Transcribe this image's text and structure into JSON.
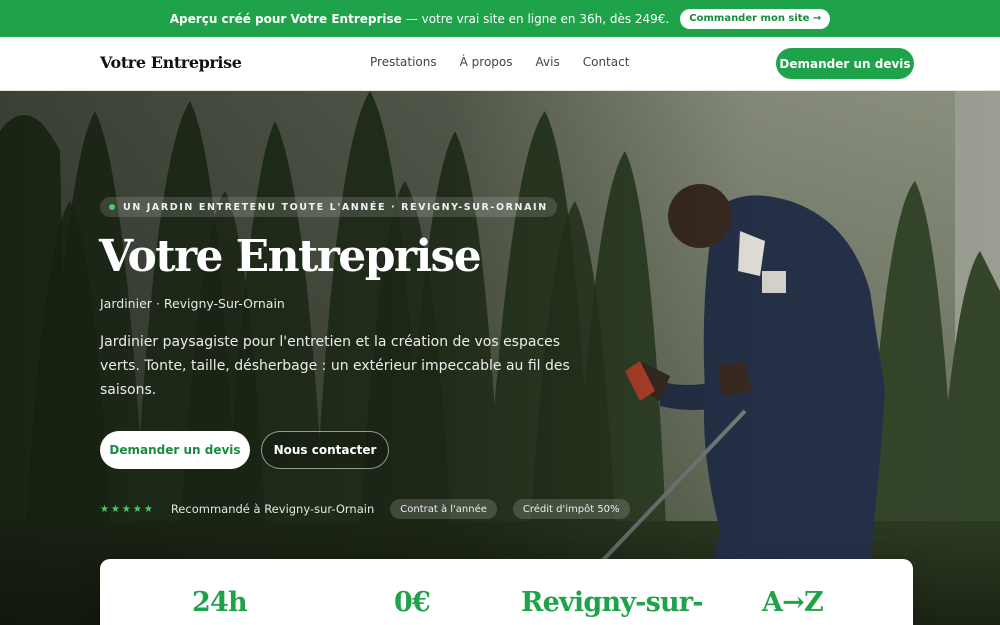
{
  "promo": {
    "bold": "Aperçu créé pour Votre Entreprise",
    "text": "— votre vrai site en ligne en 36h, dès 249€.",
    "button": "Commander mon site →"
  },
  "header": {
    "logo": "Votre Entreprise",
    "nav": [
      "Prestations",
      "À propos",
      "Avis",
      "Contact"
    ],
    "cta": "Demander un devis"
  },
  "hero": {
    "kicker": "UN JARDIN ENTRETENU TOUTE L'ANNÉE · REVIGNY-SUR-ORNAIN",
    "title": "Votre Entreprise",
    "subtitle": "Jardinier · Revigny-Sur-Ornain",
    "lead": "Jardinier paysagiste pour l'entretien et la création de vos espaces verts. Tonte, taille, désherbage : un extérieur impeccable au fil des saisons.",
    "primary_button": "Demander un devis",
    "secondary_button": "Nous contacter",
    "stars": "★★★★★",
    "trust_text": "Recommandé à Revigny-sur-Ornain",
    "badges": [
      "Contrat à l'année",
      "Crédit d'impôt 50%"
    ]
  },
  "stats": [
    "24h",
    "0€",
    "Revigny-sur-",
    "A→Z"
  ],
  "colors": {
    "accent": "#1fa34a",
    "accent_dark": "#1a8a3e"
  }
}
